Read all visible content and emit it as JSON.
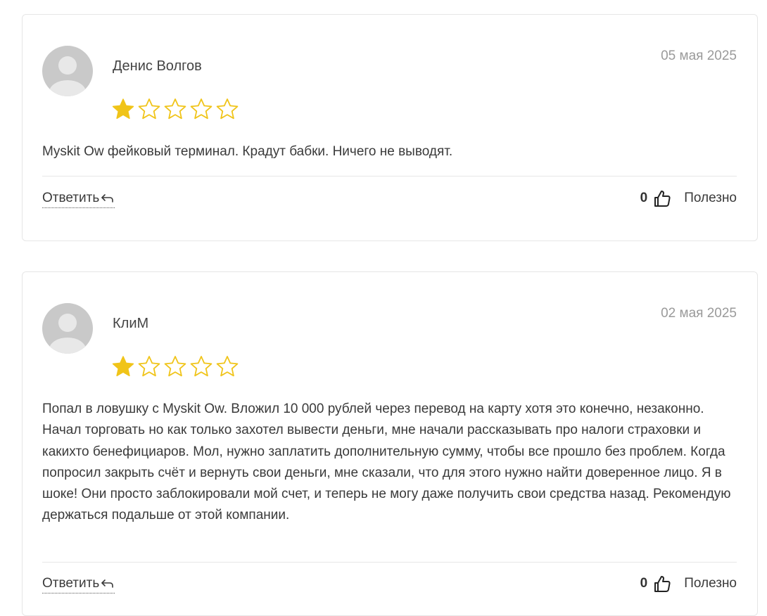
{
  "reviews": [
    {
      "author": "Денис Волгов",
      "date": "05 мая 2025",
      "rating": 1,
      "max_rating": 5,
      "text": "Myskit Ow фейковый терминал. Крадут бабки. Ничего не выводят.",
      "reply_label": "Ответить",
      "likes": "0",
      "helpful_label": "Полезно"
    },
    {
      "author": "КлиМ",
      "date": "02 мая 2025",
      "rating": 1,
      "max_rating": 5,
      "text": "Попал в ловушку с Myskit Ow. Вложил 10 000 рублей через перевод на карту хотя это конечно, незаконно. Начал торговать но как только захотел вывести деньги, мне начали рассказывать про налоги страховки и какихто бенефициаров. Мол, нужно заплатить дополнительную сумму, чтобы все прошло без проблем. Когда попросил закрыть счёт и вернуть свои деньги, мне сказали, что для этого нужно найти доверенное лицо. Я в шоке! Они просто заблокировали мой счет, и теперь не могу даже получить свои средства назад. Рекомендую держаться подальше от этой компании.",
      "reply_label": "Ответить",
      "likes": "0",
      "helpful_label": "Полезно"
    }
  ],
  "colors": {
    "star_filled": "#f0c419",
    "star_outline": "#f0c419",
    "avatar_bg": "#c9c9c9",
    "avatar_figure": "#e8e8e8",
    "border": "#e6e6e6",
    "date_text": "#9a9a9a"
  },
  "icons": {
    "avatar": "user-silhouette-icon",
    "star": "star-icon",
    "reply": "reply-arrow-icon",
    "helpful": "thumbs-up-icon"
  }
}
